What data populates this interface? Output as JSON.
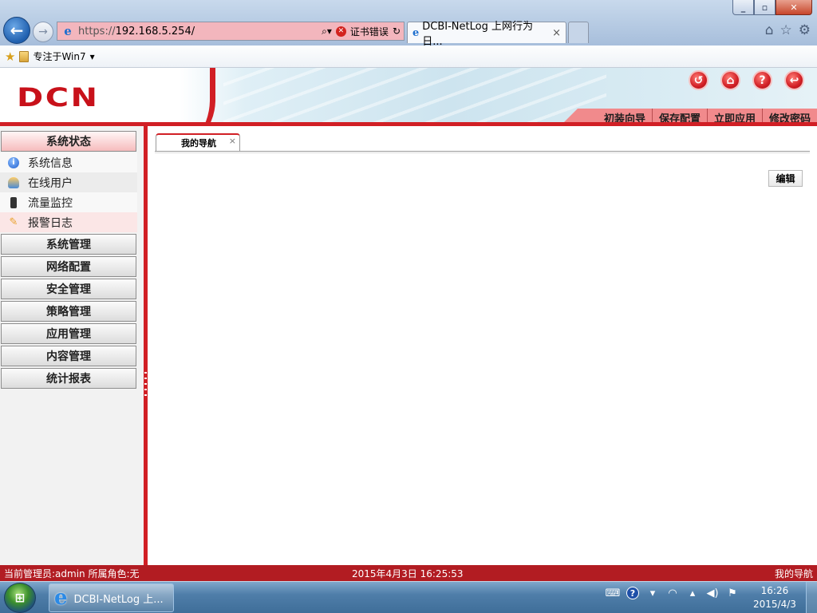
{
  "browser": {
    "address_url_prefix": "https://",
    "address_url_host": "192.168.5.254/",
    "cert_error_label": "证书错误",
    "tab_title": "DCBI-NetLog 上网行为日...",
    "tab_close_glyph": "×",
    "favorites_link": "专注于Win7",
    "icons": [
      "back-arrow-icon",
      "forward-arrow-icon",
      "ie-icon",
      "search-icon",
      "cert-error-icon",
      "refresh-icon",
      "home-icon",
      "favorites-icon",
      "gear-icon",
      "star-icon",
      "folder-icon"
    ]
  },
  "app": {
    "logo_text": "DCN",
    "header_icons": [
      "logout-icon",
      "home-icon",
      "help-icon",
      "exit-icon"
    ],
    "header_menu": [
      "初装向导",
      "保存配置",
      "立即应用",
      "修改密码"
    ],
    "sidebar": {
      "groups": [
        {
          "label": "系统状态",
          "expanded": true,
          "items": [
            {
              "label": "系统信息",
              "icon": "info-icon"
            },
            {
              "label": "在线用户",
              "icon": "user-icon"
            },
            {
              "label": "流量监控",
              "icon": "traffic-light-icon"
            },
            {
              "label": "报警日志",
              "icon": "alarm-icon"
            }
          ]
        },
        {
          "label": "系统管理"
        },
        {
          "label": "网络配置"
        },
        {
          "label": "安全管理"
        },
        {
          "label": "策略管理"
        },
        {
          "label": "应用管理"
        },
        {
          "label": "内容管理"
        },
        {
          "label": "统计报表"
        }
      ]
    },
    "content": {
      "tab_label": "我的导航",
      "tab_close_glyph": "×",
      "edit_button": "编辑"
    },
    "status_bar": {
      "left": "当前管理员:admin  所属角色:无",
      "center": "2015年4月3日  16:25:53",
      "right": "我的导航"
    }
  },
  "taskbar": {
    "task_label": "DCBI-NetLog 上...",
    "clock_time": "16:26",
    "clock_date": "2015/4/3"
  },
  "colors": {
    "brand_red": "#d11f25",
    "status_bar_red": "#b21c22",
    "header_menu_bg": "#f18a8c"
  }
}
